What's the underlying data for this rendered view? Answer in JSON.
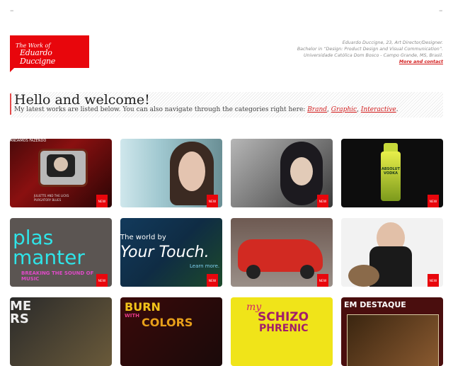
{
  "top_dash_left": "–",
  "top_dash_right": "–",
  "logo": {
    "line1": "The Work of",
    "line2": "Eduardo Duccigne"
  },
  "bio": {
    "line1": "Eduardo Duccigne, 23, Art Director/Designer.",
    "line2": "Bachelor in “Design: Product Design and Visual Communication”.",
    "line3": "Universidade Católica Dom Bosco - Campo Grande, MS, Brasil.",
    "contact": "More and contact"
  },
  "welcome": {
    "title": "Hello and welcome!",
    "text": "My latest works are listed below. You can also navigate through the categories right here:",
    "cat_brand": "Brand",
    "cat_graphic": "Graphic",
    "cat_interactive": "Interactive",
    "sep": ", ",
    "end": "."
  },
  "tiles": [
    {
      "badge": "NEW",
      "caption_top": "ANDAMOS FAZENDO",
      "caption_bottom": "JULIETTE AND THE LICKS\nPURGATORY BLUES"
    },
    {
      "badge": "NEW"
    },
    {
      "badge": "NEW"
    },
    {
      "badge": "NEW",
      "bottle_text": "ABSOLUT VODKA"
    },
    {
      "badge": "NEW",
      "text_big": "plas manter",
      "text_small": "BREAKING THE SOUND OF MUSIC"
    },
    {
      "badge": "NEW",
      "text_small": "The world by",
      "text_big": "Your Touch.",
      "text_link": "Learn more."
    },
    {
      "badge": "NEW"
    },
    {
      "badge": "NEW"
    },
    {
      "text_big": "ME RS"
    },
    {
      "text_big": "BURN",
      "text_mid": "WITH",
      "text_big2": "COLORS"
    },
    {
      "text_small": "my",
      "text_big": "SCHIZO",
      "text_big2": "PHRENIC"
    },
    {
      "text_big": "EM DESTAQUE"
    }
  ]
}
